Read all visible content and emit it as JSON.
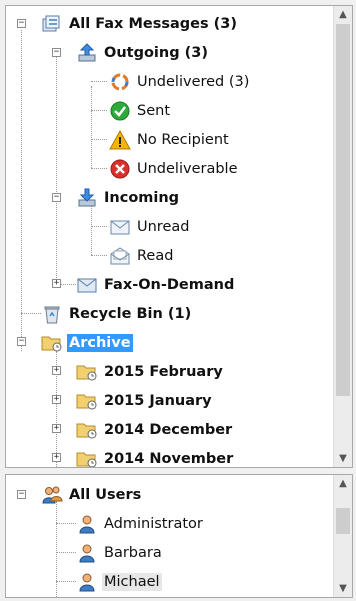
{
  "fax_tree": {
    "all_fax": "All Fax Messages (3)",
    "outgoing": "Outgoing (3)",
    "undelivered": "Undelivered (3)",
    "sent": "Sent",
    "no_recipient": "No Recipient",
    "undeliverable": "Undeliverable",
    "incoming": "Incoming",
    "unread": "Unread",
    "read": "Read",
    "fax_on_demand": "Fax-On-Demand",
    "recycle_bin": "Recycle Bin (1)",
    "archive": "Archive",
    "feb_2015": "2015 February",
    "jan_2015": "2015 January",
    "dec_2014": "2014 December",
    "nov_2014": "2014 November"
  },
  "users_tree": {
    "all_users": "All Users",
    "users": [
      "Administrator",
      "Barbara",
      "Michael"
    ]
  },
  "colors": {
    "selection": "#3399ff",
    "hover": "#e7e7e7"
  }
}
